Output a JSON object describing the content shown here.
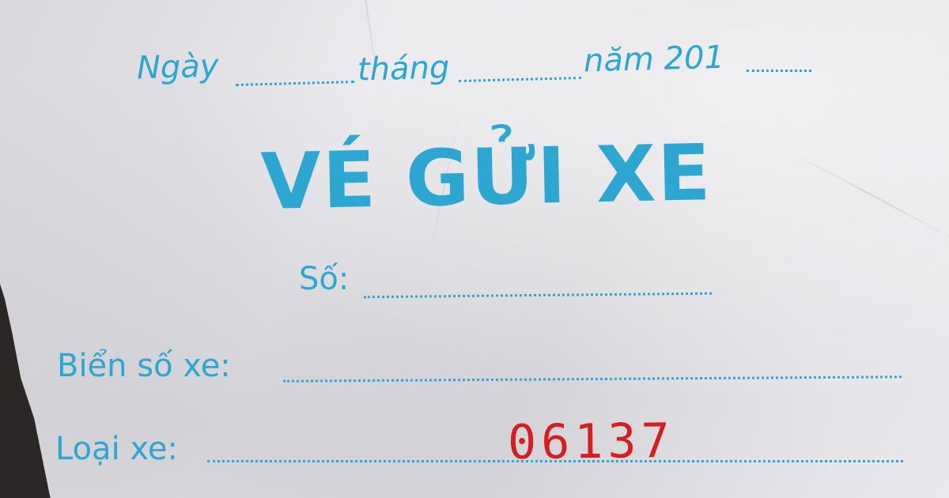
{
  "ticket": {
    "date_day_label": "Ngày",
    "date_month_label": "tháng",
    "date_year_label": "năm 201",
    "title": "VÉ GỬI XE",
    "number_label": "Số:",
    "plate_label": "Biển số xe:",
    "vehicle_type_label": "Loại xe:",
    "serial_stamp": "06137"
  },
  "colors": {
    "print_ink": "#2ea6d2",
    "stamp_ink": "#d31f22",
    "paper": "#e3e2e6",
    "background": "#2a2726"
  }
}
